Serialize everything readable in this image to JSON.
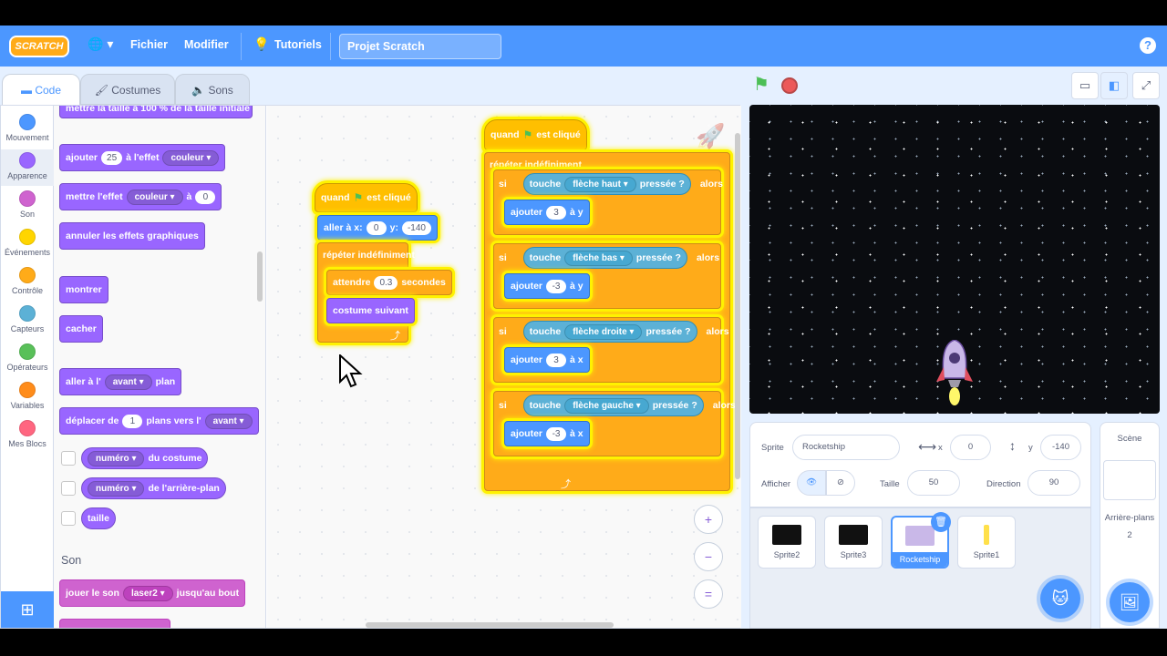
{
  "menubar": {
    "logo": "SCRATCH",
    "globe": "🌐 ▾",
    "file": "Fichier",
    "edit": "Modifier",
    "tutorials": "Tutoriels",
    "project_title": "Projet Scratch",
    "help": "?"
  },
  "tabs": {
    "code": "Code",
    "costumes": "Costumes",
    "sounds": "Sons"
  },
  "categories": [
    {
      "label": "Mouvement",
      "color": "#4c97ff"
    },
    {
      "label": "Apparence",
      "color": "#9966ff"
    },
    {
      "label": "Son",
      "color": "#cf63cf"
    },
    {
      "label": "Événements",
      "color": "#ffd500"
    },
    {
      "label": "Contrôle",
      "color": "#ffab19"
    },
    {
      "label": "Capteurs",
      "color": "#5cb1d6"
    },
    {
      "label": "Opérateurs",
      "color": "#59c059"
    },
    {
      "label": "Variables",
      "color": "#ff8c1a"
    },
    {
      "label": "Mes Blocs",
      "color": "#ff6680"
    }
  ],
  "palette": {
    "cut_top": "mettre la taille à 100 % de la taille initiale",
    "add_effect": {
      "a": "ajouter",
      "val": "25",
      "b": "à l'effet",
      "effect": "couleur"
    },
    "set_effect": {
      "a": "mettre l'effet",
      "effect": "couleur",
      "b": "à",
      "val": "0"
    },
    "clear_effects": "annuler les effets graphiques",
    "show": "montrer",
    "hide": "cacher",
    "goto_layer": {
      "a": "aller à l'",
      "layer": "avant",
      "b": "plan"
    },
    "move_layers": {
      "a": "déplacer de",
      "val": "1",
      "b": "plans vers l'",
      "dir": "avant"
    },
    "costume_rep": {
      "dd": "numéro",
      "txt": "du costume"
    },
    "backdrop_rep": {
      "dd": "numéro",
      "txt": "de l'arrière-plan"
    },
    "size_rep": "taille",
    "sound_header": "Son",
    "play_sound": {
      "a": "jouer le son",
      "sound": "laser2",
      "b": "jusqu'au bout"
    }
  },
  "script1": {
    "hat": {
      "a": "quand",
      "b": "est cliqué"
    },
    "goto": {
      "a": "aller à x:",
      "x": "0",
      "b": "y:",
      "y": "-140"
    },
    "forever": "répéter indéfiniment",
    "wait": {
      "a": "attendre",
      "val": "0.3",
      "b": "secondes"
    },
    "next_costume": "costume suivant"
  },
  "script2": {
    "hat": {
      "a": "quand",
      "b": "est cliqué"
    },
    "forever": "répéter indéfiniment",
    "ifs": [
      {
        "si": "si",
        "touch": "touche",
        "key": "flèche haut",
        "pressed": "pressée ?",
        "alors": "alors",
        "add": "ajouter",
        "val": "3",
        "axis": "à y"
      },
      {
        "si": "si",
        "touch": "touche",
        "key": "flèche bas",
        "pressed": "pressée ?",
        "alors": "alors",
        "add": "ajouter",
        "val": "-3",
        "axis": "à y"
      },
      {
        "si": "si",
        "touch": "touche",
        "key": "flèche droite",
        "pressed": "pressée ?",
        "alors": "alors",
        "add": "ajouter",
        "val": "3",
        "axis": "à x"
      },
      {
        "si": "si",
        "touch": "touche",
        "key": "flèche gauche",
        "pressed": "pressée ?",
        "alors": "alors",
        "add": "ajouter",
        "val": "-3",
        "axis": "à x"
      }
    ]
  },
  "zoom": {
    "in": "+",
    "out": "−",
    "reset": "="
  },
  "sprite_info": {
    "sprite_label": "Sprite",
    "sprite_name": "Rocketship",
    "x_label": "x",
    "x": "0",
    "y_label": "y",
    "y": "-140",
    "show_label": "Afficher",
    "size_label": "Taille",
    "size": "50",
    "dir_label": "Direction",
    "dir": "90"
  },
  "sprites": [
    {
      "name": "Sprite2",
      "color": "#111"
    },
    {
      "name": "Sprite3",
      "color": "#111"
    },
    {
      "name": "Rocketship",
      "color": "#c9b8e8",
      "selected": true
    },
    {
      "name": "Sprite1",
      "color": "#fff"
    }
  ],
  "scene": {
    "title": "Scène",
    "backdrops_label": "Arrière-plans",
    "backdrops_count": "2"
  }
}
